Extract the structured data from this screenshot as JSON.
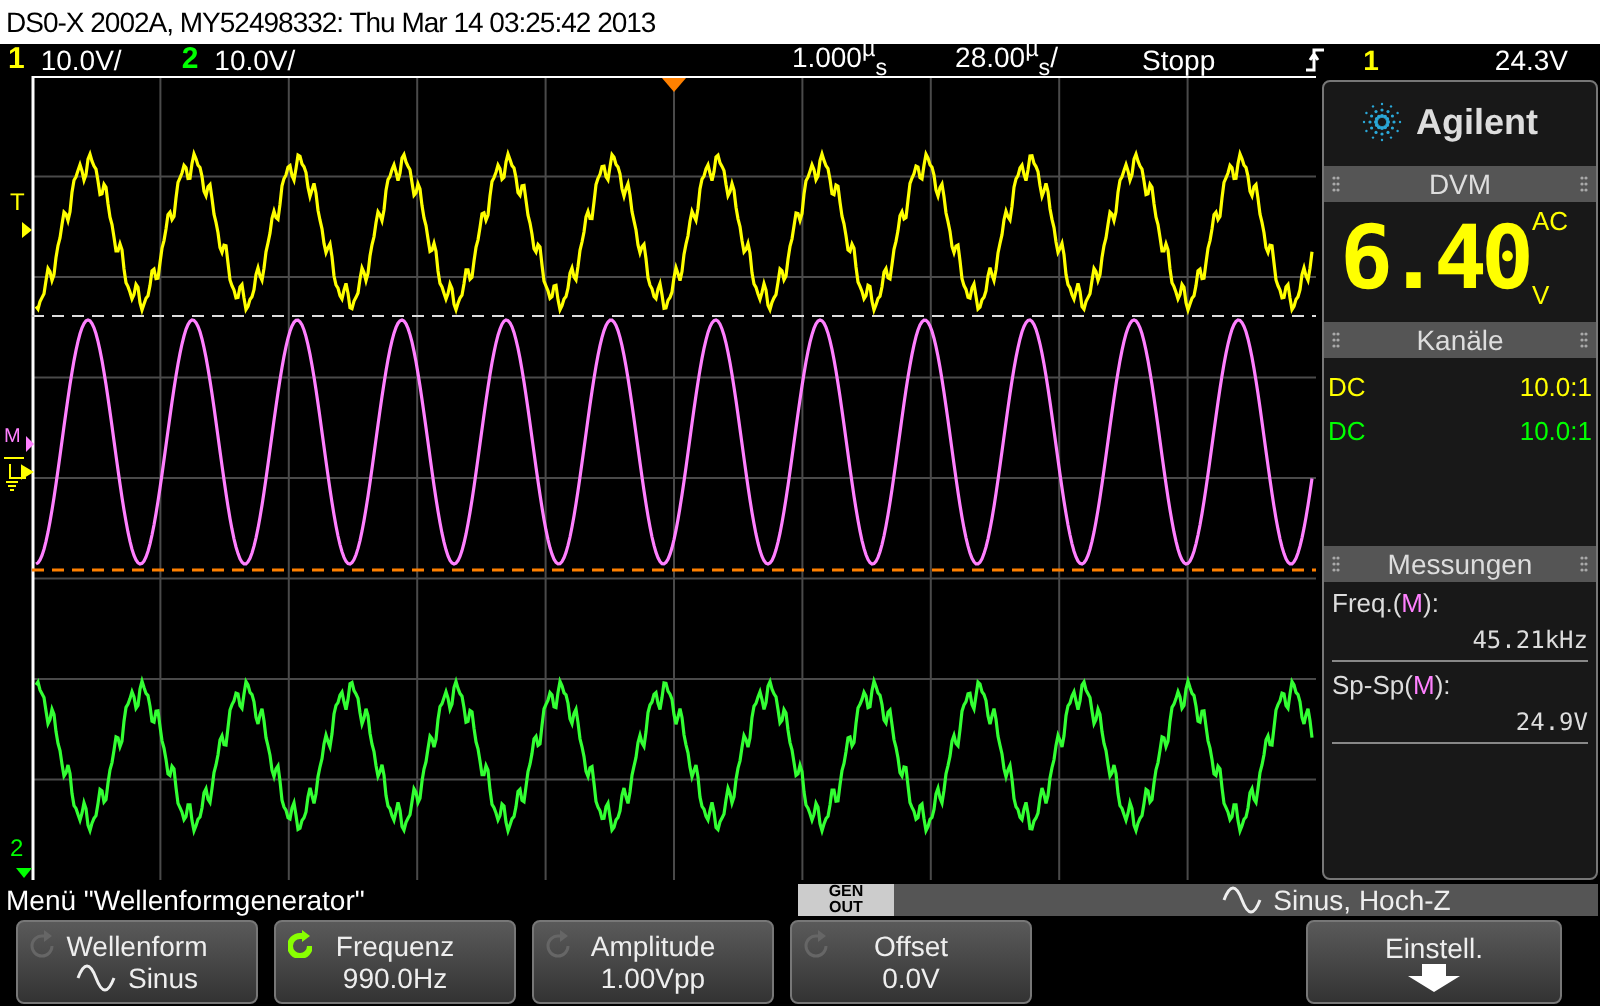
{
  "title": "DS0-X 2002A, MY52498332: Thu Mar 14 03:25:42 2013",
  "status_bar": {
    "channels": [
      {
        "number": "1",
        "scale": "10.0V/",
        "color": "#ffff00"
      },
      {
        "number": "2",
        "scale": "10.0V/",
        "color": "#00ff00"
      }
    ],
    "delay": "1.000$^{µ}$$_{s}$",
    "timebase": "28.00$^{µ}$$_{s}$/",
    "run_state": "Stopp",
    "trigger": {
      "source": "1",
      "color": "#ffff00",
      "level": "24.3V"
    }
  },
  "markers": [
    {
      "text": "T",
      "color": "#ffff00",
      "kind": "trigger"
    },
    {
      "text": "M",
      "color": "#ff80ff",
      "kind": "math"
    },
    {
      "text": "2",
      "color": "#00ff00",
      "kind": "channel"
    }
  ],
  "panel": {
    "logo": "Agilent",
    "dvm": {
      "title": "DVM",
      "reading": "6.40",
      "mode": "AC",
      "unit": "V"
    },
    "channels": {
      "title": "Kanäle",
      "rows": [
        {
          "coupling": "DC",
          "probe": "10.0:1",
          "color": "#ffff00"
        },
        {
          "coupling": "DC",
          "probe": "10.0:1",
          "color": "#00ff00"
        }
      ]
    },
    "measurements": {
      "title": "Messungen",
      "items": [
        {
          "label_before": "Freq.(",
          "source": {
            "text": "M",
            "color": "#ff80ff"
          },
          "label_after": "):",
          "value": "45.21kHz"
        },
        {
          "label_before": "Sp-Sp(",
          "source": {
            "text": "M",
            "color": "#ff80ff"
          },
          "label_after": "):",
          "value": "24.9V"
        }
      ]
    }
  },
  "menu_bar": {
    "title": "Menü \"Wellenformgenerator\"",
    "badge": [
      "GEN",
      "OUT"
    ],
    "summary": "Sinus, Hoch-Z"
  },
  "softkeys": [
    {
      "kind": "waveform",
      "label": "Wellenform",
      "value": "Sinus",
      "active": false
    },
    {
      "kind": "knob",
      "label": "Frequenz",
      "value": "990.0Hz",
      "active": true
    },
    {
      "kind": "knob",
      "label": "Amplitude",
      "value": "1.00Vpp",
      "active": false
    },
    {
      "kind": "knob",
      "label": "Offset",
      "value": "0.0V",
      "active": false
    },
    {
      "kind": "submenu",
      "label": "Einstell."
    }
  ]
}
